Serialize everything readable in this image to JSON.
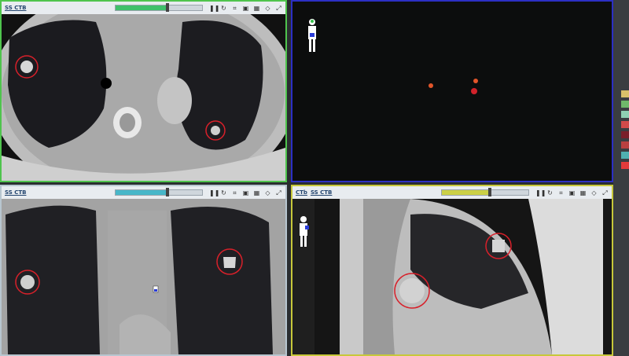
{
  "panes": {
    "axial": {
      "label": "SS CTB",
      "slider_fill": "#3fc06a",
      "level": 0.6
    },
    "coronal": {
      "label": "SS CTB",
      "slider_fill": "#47b7c9",
      "level": 0.6
    },
    "sagittal": {
      "label": "SS CTB",
      "label2": "CTb",
      "slider_fill": "#cbd046",
      "level": 0.55
    }
  },
  "colors": {
    "axial_border": "#4fc44d",
    "pet_border": "#2c2fc4",
    "sagittal_border": "#c7c83a",
    "contour": "#d8202a"
  },
  "icons": [
    "pause-icon",
    "rotate-icon",
    "crop-icon",
    "camera-icon",
    "layout-icon",
    "reset-icon",
    "fullscreen-icon"
  ],
  "legend_swatches": [
    "#d9c06a",
    "#6fb86a",
    "#8fd0b3",
    "#d24a4a",
    "#7a1f2a",
    "#b94040",
    "#4fb0b0",
    "#e23b3b"
  ]
}
